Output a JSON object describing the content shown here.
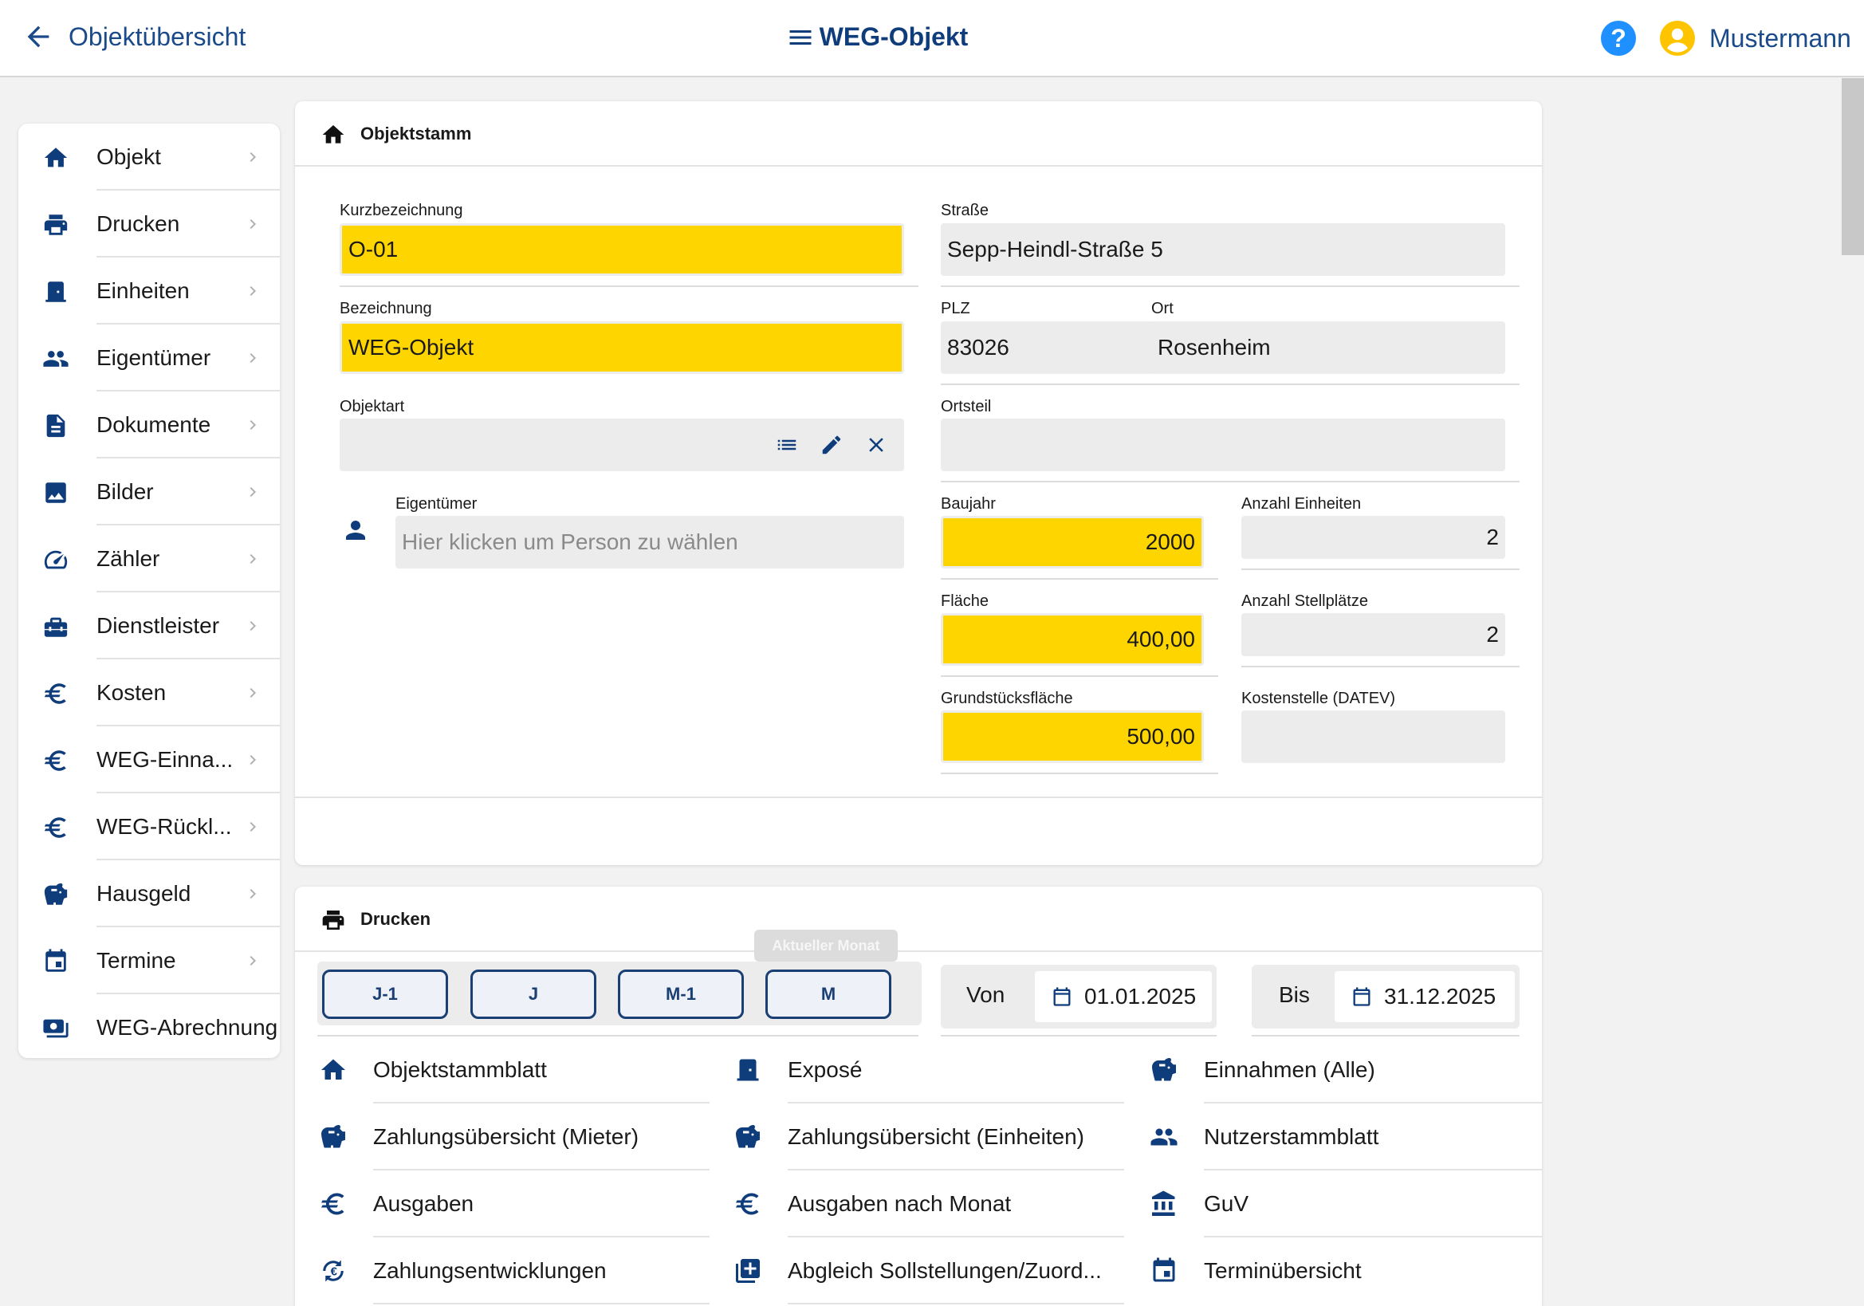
{
  "header": {
    "back_label": "Objektübersicht",
    "title": "WEG-Objekt",
    "user_name": "Mustermann"
  },
  "sidebar": {
    "items": [
      {
        "label": "Objekt",
        "icon": "home-icon"
      },
      {
        "label": "Drucken",
        "icon": "printer-icon"
      },
      {
        "label": "Einheiten",
        "icon": "door-icon"
      },
      {
        "label": "Eigentümer",
        "icon": "people-icon"
      },
      {
        "label": "Dokumente",
        "icon": "document-icon"
      },
      {
        "label": "Bilder",
        "icon": "image-icon"
      },
      {
        "label": "Zähler",
        "icon": "speedometer-icon"
      },
      {
        "label": "Dienstleister",
        "icon": "toolbox-icon"
      },
      {
        "label": "Kosten",
        "icon": "euro-icon"
      },
      {
        "label": "WEG-Einna...",
        "icon": "euro-icon"
      },
      {
        "label": "WEG-Rückl...",
        "icon": "euro-icon"
      },
      {
        "label": "Hausgeld",
        "icon": "piggy-bank-icon"
      },
      {
        "label": "Termine",
        "icon": "calendar-icon"
      },
      {
        "label": "WEG-Abrechnung",
        "icon": "cash-icon"
      }
    ]
  },
  "objektstamm": {
    "heading": "Objektstamm",
    "kurzbezeichnung": {
      "label": "Kurzbezeichnung",
      "value": "O-01"
    },
    "bezeichnung": {
      "label": "Bezeichnung",
      "value": "WEG-Objekt"
    },
    "objektart": {
      "label": "Objektart",
      "value": ""
    },
    "eigentuemer": {
      "label": "Eigentümer",
      "placeholder": "Hier klicken um Person zu wählen"
    },
    "strasse": {
      "label": "Straße",
      "value": "Sepp-Heindl-Straße 5"
    },
    "plz": {
      "label": "PLZ",
      "value": "83026"
    },
    "ort": {
      "label": "Ort",
      "value": "Rosenheim"
    },
    "ortsteil": {
      "label": "Ortsteil",
      "value": ""
    },
    "baujahr": {
      "label": "Baujahr",
      "value": "2000"
    },
    "anzahl_einheiten": {
      "label": "Anzahl Einheiten",
      "value": "2"
    },
    "flaeche": {
      "label": "Fläche",
      "value": "400,00"
    },
    "anzahl_stellplaetze": {
      "label": "Anzahl Stellplätze",
      "value": "2"
    },
    "grundstuecksflaeche": {
      "label": "Grundstücksfläche",
      "value": "500,00"
    },
    "kostenstelle": {
      "label": "Kostenstelle (DATEV)",
      "value": ""
    }
  },
  "drucken": {
    "heading": "Drucken",
    "period_buttons": [
      "J-1",
      "J",
      "M-1",
      "M"
    ],
    "tooltip": "Aktueller Monat",
    "von_label": "Von",
    "von_value": "01.01.2025",
    "bis_label": "Bis",
    "bis_value": "31.12.2025",
    "items": [
      {
        "label": "Objektstammblatt",
        "icon": "home-icon"
      },
      {
        "label": "Exposé",
        "icon": "door-icon"
      },
      {
        "label": "Einnahmen (Alle)",
        "icon": "piggy-bank-icon"
      },
      {
        "label": "Zahlungsübersicht (Mieter)",
        "icon": "piggy-bank-icon"
      },
      {
        "label": "Zahlungsübersicht (Einheiten)",
        "icon": "piggy-bank-icon"
      },
      {
        "label": "Nutzerstammblatt",
        "icon": "people-icon"
      },
      {
        "label": "Ausgaben",
        "icon": "euro-icon"
      },
      {
        "label": "Ausgaben nach Monat",
        "icon": "euro-icon"
      },
      {
        "label": "GuV",
        "icon": "bank-icon"
      },
      {
        "label": "Zahlungsentwicklungen",
        "icon": "euro-cycle-icon"
      },
      {
        "label": "Abgleich Sollstellungen/Zuord...",
        "icon": "note-plus-icon"
      },
      {
        "label": "Terminübersicht",
        "icon": "calendar-icon"
      }
    ]
  },
  "colors": {
    "primary": "#0f3c7a",
    "accent_yellow": "#ffd500",
    "help_blue": "#1e90ff"
  }
}
